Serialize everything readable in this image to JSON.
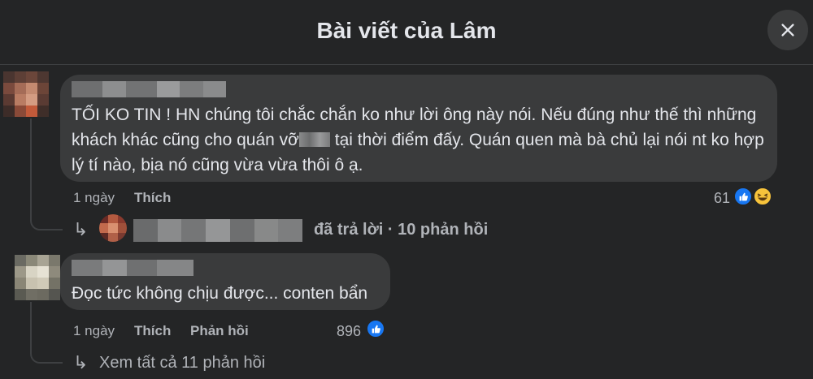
{
  "header": {
    "title": "Bài viết của Lâm",
    "close_icon": "close-icon"
  },
  "comments": [
    {
      "text_before_blur": "TỐI KO TIN ! HN chúng tôi chắc chắn ko như lời ông này nói. Nếu đúng như thế thì những khách khác cũng cho quán vỡ",
      "text_after_blur": " tại thời điểm đấy. Quán quen mà bà chủ lại nói nt ko hợp lý tí nào, bịa nó cũng vừa vừa thôi ô ạ.",
      "time": "1 ngày",
      "like_label": "Thích",
      "reaction_count": "61",
      "reactions": [
        "like-icon",
        "haha-icon"
      ],
      "reply_summary": "đã trả lời · 10 phản hồi"
    },
    {
      "text": "Đọc tức không chịu được... conten bẩn",
      "time": "1 ngày",
      "like_label": "Thích",
      "reply_label": "Phản hồi",
      "reaction_count": "896",
      "reactions": [
        "like-icon"
      ],
      "view_replies": "Xem tất cả 11 phản hồi"
    }
  ],
  "colors": {
    "background": "#242526",
    "bubble": "#3a3b3c",
    "text": "#e4e6eb",
    "secondary_text": "#b0b3b8",
    "like_blue": "#1877f2"
  }
}
